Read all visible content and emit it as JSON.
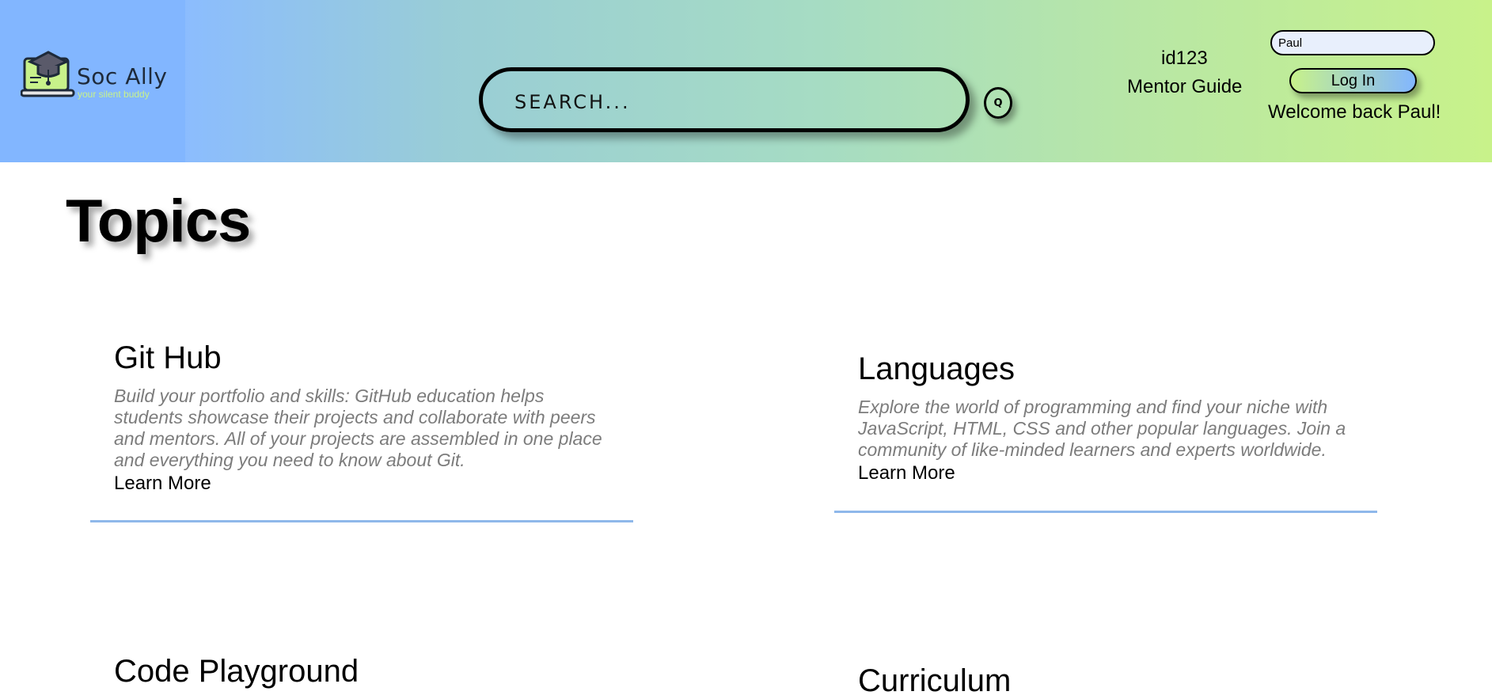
{
  "brand": {
    "name": "Soc Ally",
    "tagline": "your silent buddy",
    "logo_icon": "graduation-cap-laptop-icon"
  },
  "search": {
    "placeholder": "SEARCH...",
    "button_label": "Q"
  },
  "user": {
    "id": "id123",
    "mentor_link": "Mentor Guide",
    "username_value": "Paul",
    "login_label": "Log In",
    "welcome": "Welcome back Paul!"
  },
  "main": {
    "title": "Topics",
    "cards": [
      {
        "title": "Git Hub",
        "description": "Build your portfolio and skills: GitHub education helps students showcase their projects and collaborate with peers and mentors. All of your projects are assembled in one place and everything you need to know about Git.",
        "link": "Learn More"
      },
      {
        "title": "Languages",
        "description": "Explore the world of programming and find your niche with JavaScript, HTML, CSS and other popular languages. Join a community of like-minded learners and experts worldwide.",
        "link": "Learn More"
      },
      {
        "title": "Code Playground",
        "description": "",
        "link": ""
      },
      {
        "title": "Curriculum",
        "description": "",
        "link": ""
      }
    ]
  },
  "colors": {
    "header_left": "#82b6ff",
    "header_right": "#c8f28a",
    "divider": "#8fb8ea",
    "description_text": "#7c7c7c"
  }
}
